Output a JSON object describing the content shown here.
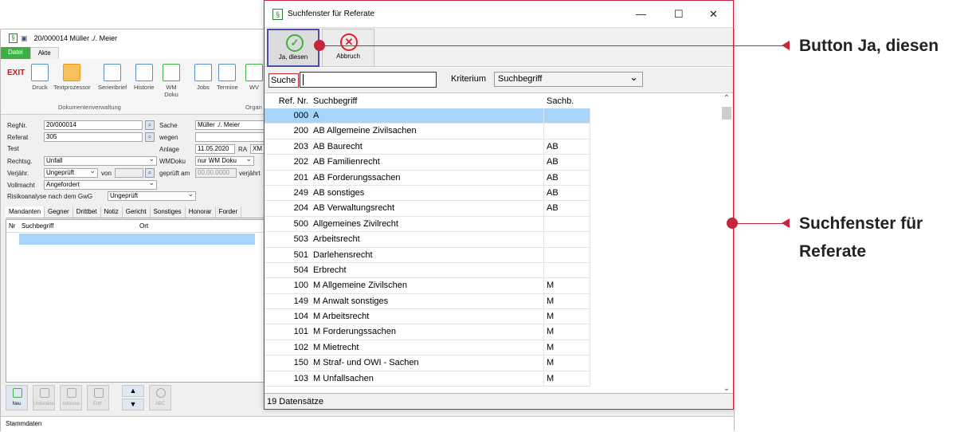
{
  "background": {
    "title": "20/000014 Müller ./. Meier",
    "ribbon_tabs": [
      "Datei",
      "Akte"
    ],
    "exit_label": "EXIT",
    "ribbon_buttons": [
      "Druck",
      "Textprozessor",
      "Serienbrief",
      "Historie",
      "WM Doku",
      "Jobs",
      "Termine",
      "WV"
    ],
    "group_labels": [
      "Dokumentenverwaltung",
      "Organ"
    ],
    "form": {
      "regnr_label": "RegNr.",
      "regnr_value": "20/000014",
      "referat_label": "Referat",
      "referat_value": "305",
      "test_label": "Test",
      "rechtsg_label": "Rechtsg.",
      "rechtsg_value": "Unfall",
      "verjaehr_label": "Verjähr.",
      "verjaehr_value": "Ungeprüft",
      "von_label": "von",
      "vollmacht_label": "Vollmacht",
      "vollmacht_value": "Angefordert",
      "risiko_label": "Risikoanalyse nach dem GwG",
      "risiko_value": "Ungeprüft",
      "sache_label": "Sache",
      "sache_value": "Müller ./. Meier",
      "wegen_label": "wegen",
      "anlage_label": "Anlage",
      "anlage_value": "11.05.2020",
      "ra_label": "RA",
      "ra_value": "XM",
      "wmdoku_label": "WMDoku",
      "wmdoku_value": "nur WM Doku",
      "geprueft_label": "geprüft am",
      "geprueft_value": "00.00.0000",
      "verjaehrt_label": "verjährt"
    },
    "bottom_tabs": [
      "Mandanten",
      "Gegner",
      "Drittbet",
      "Notiz",
      "Gericht",
      "Sonstiges",
      "Honorar",
      "Forder"
    ],
    "grid_headers": [
      "Nr",
      "Suchbegriff",
      "Ort"
    ],
    "bottom_buttons": [
      "Neu",
      "Unterakte",
      "Adresse",
      "Entf.",
      "ABC"
    ],
    "status_tab": "Stammdaten"
  },
  "dialog": {
    "title": "Suchfenster für Referate",
    "window_controls": {
      "minimize": "—",
      "maximize": "☐",
      "close": "✕"
    },
    "ja_button": "Ja, diesen",
    "abbruch_button": "Abbruch",
    "search_label": "Suche",
    "search_value": "",
    "kriterium_label": "Kriterium",
    "kriterium_value": "Suchbegriff",
    "columns": [
      "Ref. Nr.",
      "Suchbegriff",
      "Sachb."
    ],
    "rows": [
      {
        "ref": "000",
        "such": "A",
        "sachb": ""
      },
      {
        "ref": "200",
        "such": "AB Allgemeine Zivilsachen",
        "sachb": ""
      },
      {
        "ref": "203",
        "such": "AB Baurecht",
        "sachb": "AB"
      },
      {
        "ref": "202",
        "such": "AB Familienrecht",
        "sachb": "AB"
      },
      {
        "ref": "201",
        "such": "AB Forderungssachen",
        "sachb": "AB"
      },
      {
        "ref": "249",
        "such": "AB sonstiges",
        "sachb": "AB"
      },
      {
        "ref": "204",
        "such": "AB Verwaltungsrecht",
        "sachb": "AB"
      },
      {
        "ref": "500",
        "such": "Allgemeines Zivilrecht",
        "sachb": ""
      },
      {
        "ref": "503",
        "such": "Arbeitsrecht",
        "sachb": ""
      },
      {
        "ref": "501",
        "such": "Darlehensrecht",
        "sachb": ""
      },
      {
        "ref": "504",
        "such": "Erbrecht",
        "sachb": ""
      },
      {
        "ref": "100",
        "such": "M Allgemeine Zivilschen",
        "sachb": "M"
      },
      {
        "ref": "149",
        "such": "M Anwalt sonstiges",
        "sachb": "M"
      },
      {
        "ref": "104",
        "such": "M Arbeitsrecht",
        "sachb": "M"
      },
      {
        "ref": "101",
        "such": "M Forderungssachen",
        "sachb": "M"
      },
      {
        "ref": "102",
        "such": "M Mietrecht",
        "sachb": "M"
      },
      {
        "ref": "150",
        "such": "M Straf- und OWI - Sachen",
        "sachb": "M"
      },
      {
        "ref": "103",
        "such": "M Unfallsachen",
        "sachb": "M"
      }
    ],
    "status": "19 Datensätze"
  },
  "callouts": {
    "button": "Button Ja, diesen",
    "window_line1": "Suchfenster für",
    "window_line2": "Referate"
  },
  "colors": {
    "accent": "#c4263b",
    "selection": "#a6d4fa",
    "green": "#3cb043"
  }
}
